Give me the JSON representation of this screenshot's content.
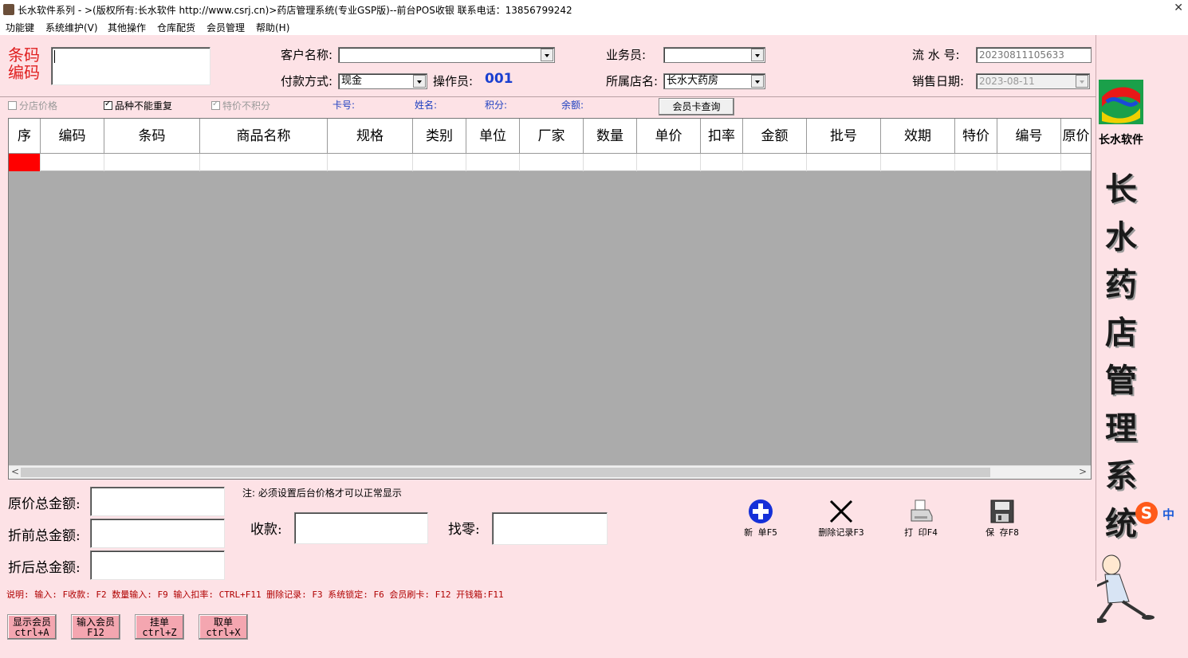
{
  "window": {
    "title": "长水软件系列 - >(版权所有:长水软件 http://www.csrj.cn)>药店管理系统(专业GSP版)--前台POS收银   联系电话：13856799242",
    "close": "✕"
  },
  "menu": [
    "功能键",
    "系统维护(V)",
    "其他操作",
    "仓库配货",
    "会员管理",
    "帮助(H)"
  ],
  "barcode": {
    "label1": "条码",
    "label2": "编码",
    "value": ""
  },
  "customer": {
    "label": "客户名称:",
    "value": ""
  },
  "payment": {
    "label": "付款方式:",
    "value": "现金"
  },
  "operator": {
    "label": "操作员:",
    "value": "001"
  },
  "salesman": {
    "label": "业务员:",
    "value": ""
  },
  "store": {
    "label": "所属店名:",
    "value": "长水大药房"
  },
  "serial": {
    "label": "流 水 号:",
    "value": "20230811105633"
  },
  "sale_date": {
    "label": "销售日期:",
    "value": "2023-08-11"
  },
  "options": {
    "store_price": "分店价格",
    "no_repeat": "品种不能重复",
    "special_no_points": "特价不积分"
  },
  "member": {
    "card_label": "卡号:",
    "name_label": "姓名:",
    "points_label": "积分:",
    "balance_label": "余额:",
    "query_button": "会员卡查询"
  },
  "grid": {
    "columns": [
      "序",
      "编码",
      "条码",
      "商品名称",
      "规格",
      "类别",
      "单位",
      "厂家",
      "数量",
      "单价",
      "扣率",
      "金额",
      "批号",
      "效期",
      "特价",
      "编号",
      "原价"
    ]
  },
  "totals": {
    "original_label": "原价总金额:",
    "before_discount_label": "折前总金额:",
    "after_discount_label": "折后总金额:",
    "note": "注: 必须设置后台价格才可以正常显示",
    "received_label": "收款:",
    "change_label": "找零:"
  },
  "tools": {
    "new": "新 单F5",
    "delete": "删除记录F3",
    "print": "打 印F4",
    "save": "保 存F8"
  },
  "hint": "说明: 输入: F收款: F2 数量输入: F9 输入扣率: CTRL+F11 删除记录: F3 系统锁定: F6   会员刷卡: F12   开钱箱:F11",
  "bottom_buttons": [
    {
      "line1": "显示会员",
      "line2": "ctrl+A"
    },
    {
      "line1": "输入会员",
      "line2": "F12"
    },
    {
      "line1": "挂单",
      "line2": "ctrl+Z"
    },
    {
      "line1": "取单",
      "line2": "ctrl+X"
    }
  ],
  "brand": {
    "company": "长水软件",
    "vertical": [
      "长",
      "水",
      "药",
      "店",
      "管",
      "理",
      "系",
      "统"
    ],
    "ime": "中"
  }
}
